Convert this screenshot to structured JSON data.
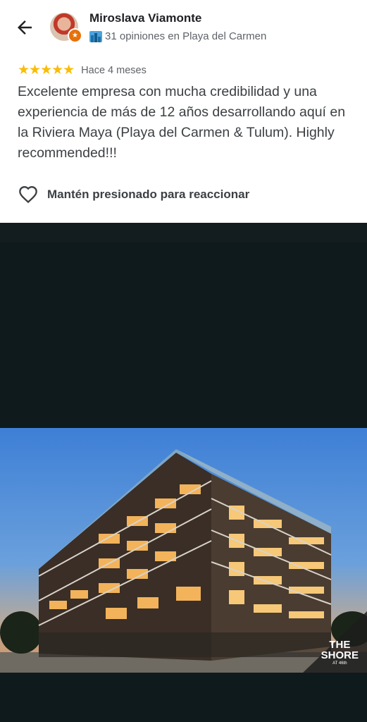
{
  "review": {
    "author_name": "Miroslava Viamonte",
    "author_meta": "31 opiniones en Playa del Carmen",
    "stars_text": "★★★★★",
    "rating": 5,
    "time_ago": "Hace 4 meses",
    "text": "Excelente empresa con mucha credibilidad y una experiencia de más de 12 años desarrollando aquí en la Riviera Maya (Playa del Carmen & Tulum). Highly recommended!!!",
    "react_label": "Mantén presionado para reaccionar"
  },
  "photo": {
    "logo_line1": "THE",
    "logo_line2": "SHORE",
    "logo_line3": "AT 46th"
  },
  "colors": {
    "star": "#fbbc04",
    "badge": "#e8710a",
    "background": "#0f1a1c"
  },
  "icons": [
    "arrow-back-icon",
    "local-guide-badge-icon",
    "city-icon",
    "heart-outline-icon"
  ]
}
